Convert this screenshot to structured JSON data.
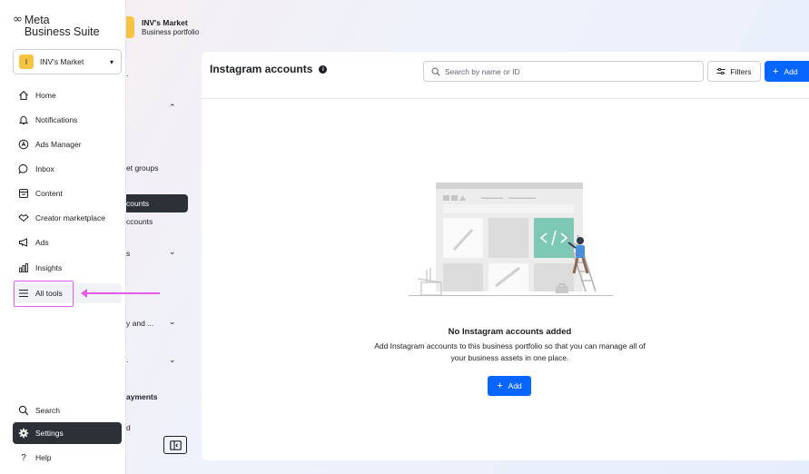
{
  "brand": {
    "logo_mark": "∞",
    "line1": "Meta",
    "line2": "Business Suite"
  },
  "account_selector": {
    "initial": "I",
    "name": "INV's Market",
    "caret": "▾"
  },
  "nav": {
    "home": "Home",
    "notifications": "Notifications",
    "ads_manager": "Ads Manager",
    "inbox": "Inbox",
    "content": "Content",
    "creator_marketplace": "Creator marketplace",
    "ads": "Ads",
    "insights": "Insights",
    "all_tools": "All tools",
    "search": "Search",
    "settings": "Settings",
    "help": "Help"
  },
  "subnav": {
    "frag_dot": "·",
    "frag_groups": "et groups",
    "frag_active": "counts",
    "frag_accounts": "ccounts",
    "frag_s": "s",
    "frag_and": "y and ...",
    "frag_dot2": "·",
    "frag_payments": "ayments",
    "frag_d": "d",
    "chevron_up": "⌃",
    "chevron_down": "⌄"
  },
  "portfolio": {
    "name": "INV's Market",
    "subtitle": "Business portfolio"
  },
  "page": {
    "title": "Instagram accounts",
    "info": "i",
    "search_placeholder": "Search by name or ID",
    "filters_label": "Filters",
    "add_label": "Add"
  },
  "empty_state": {
    "title": "No Instagram accounts added",
    "description": "Add Instagram accounts to this business portfolio so that you can manage all of your business assets in one place.",
    "add_label": "Add"
  },
  "colors": {
    "accent": "#0866ff",
    "highlight": "#e45ce5",
    "active_dark": "#2b3137",
    "brand_yellow": "#f6c343"
  }
}
